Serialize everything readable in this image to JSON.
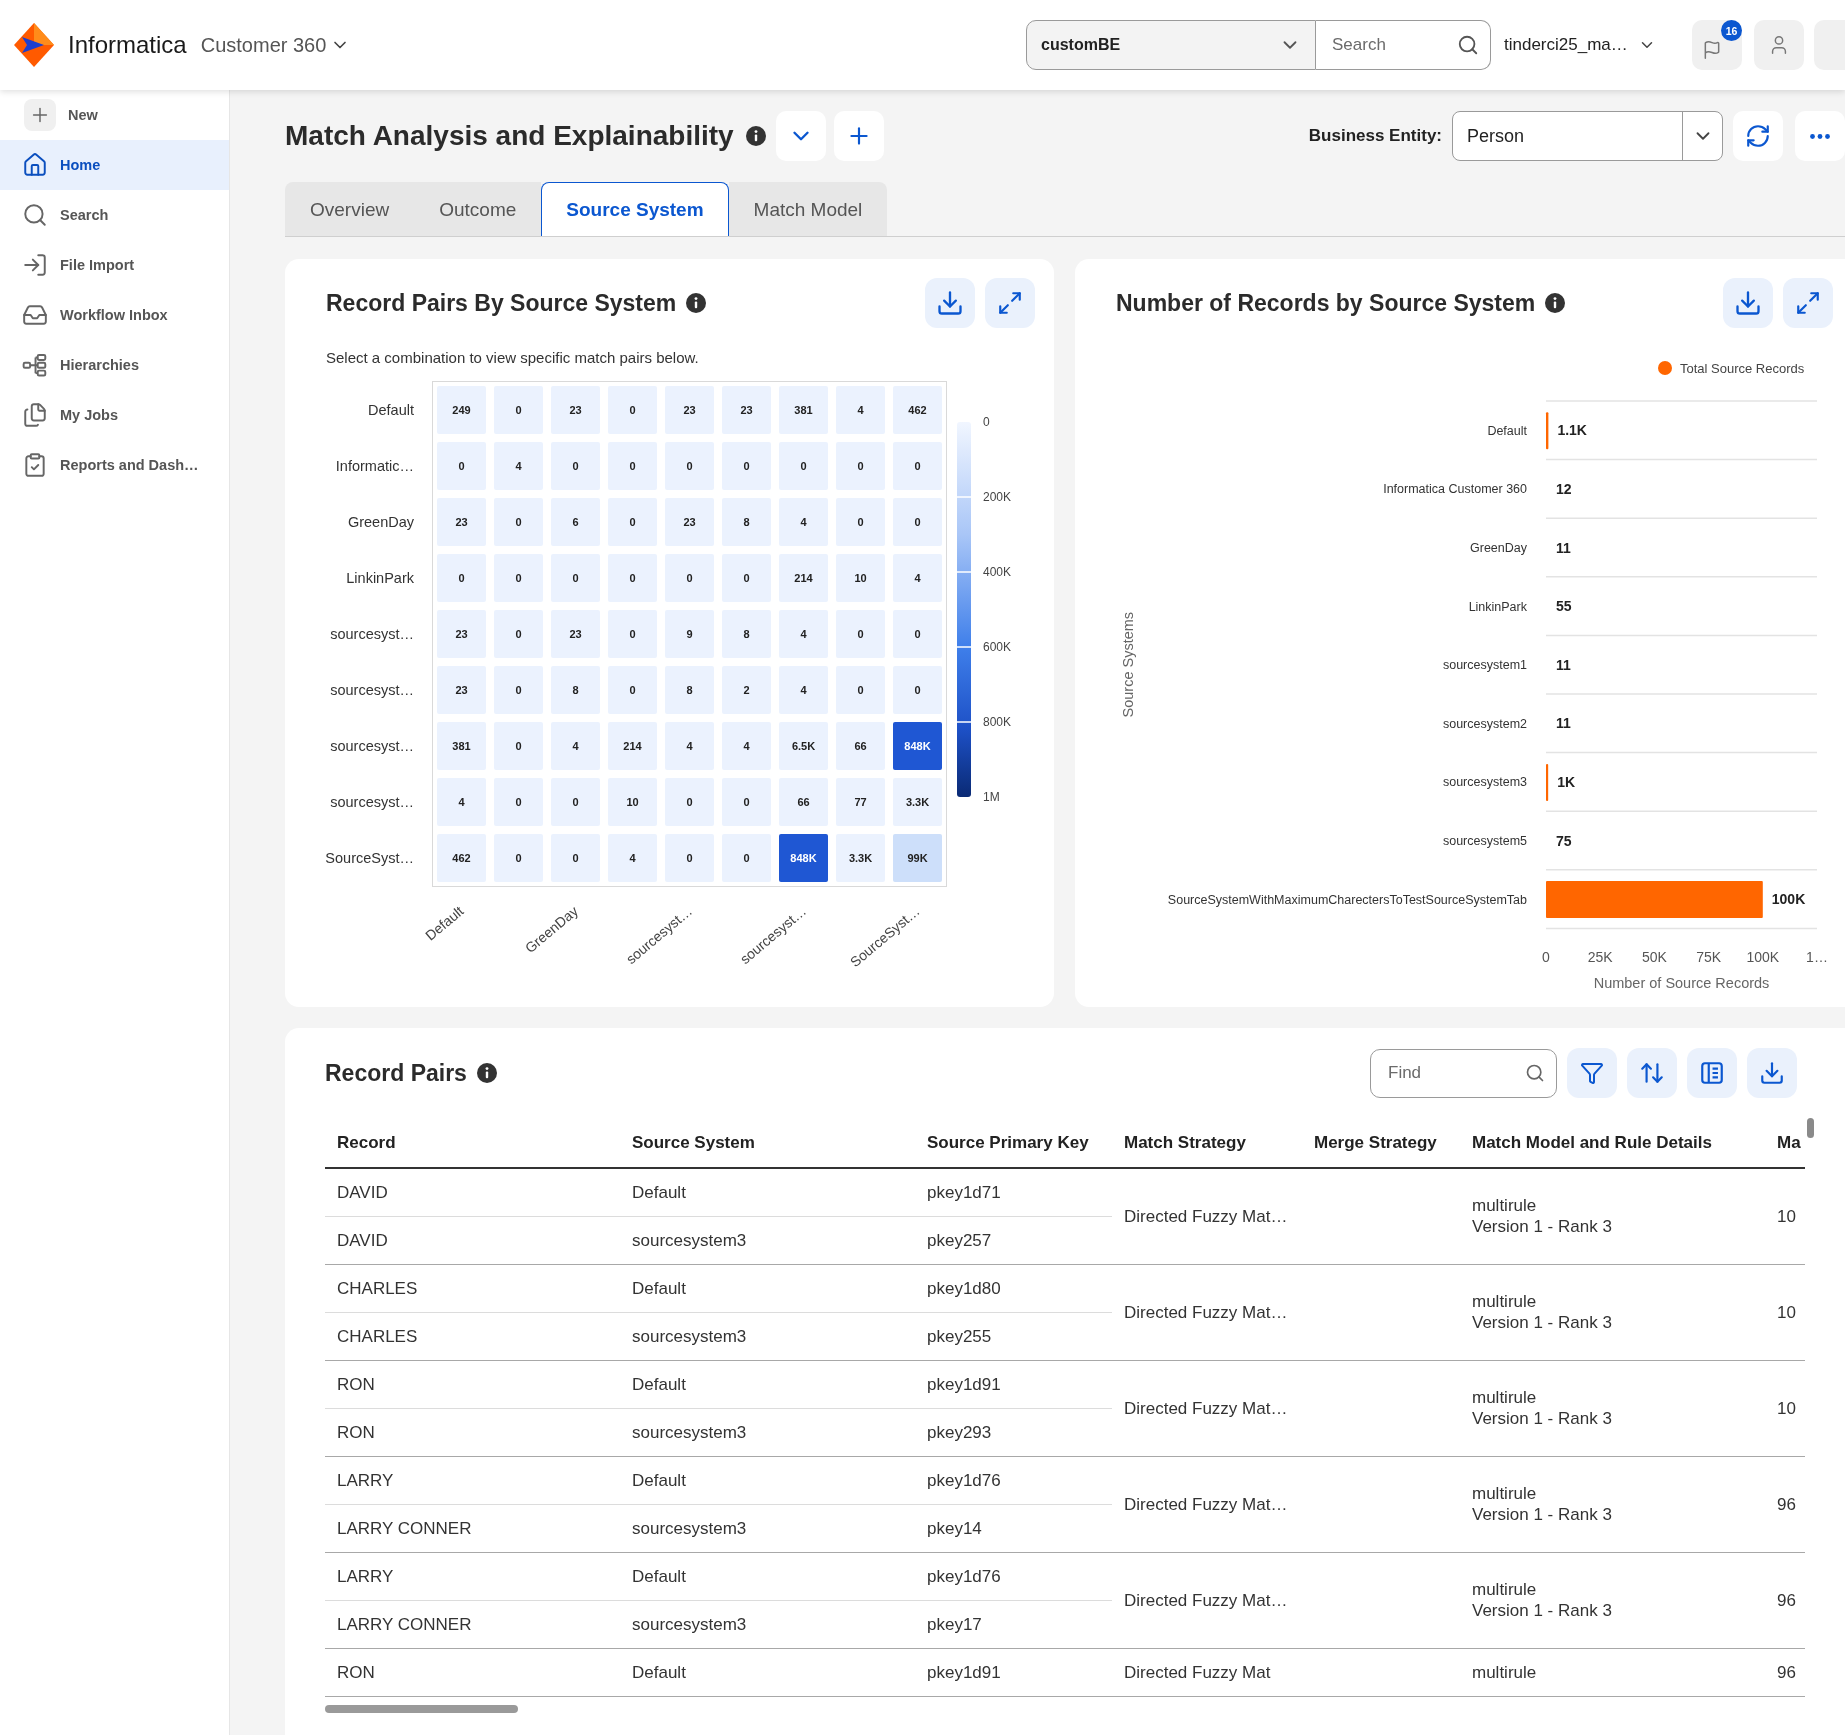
{
  "header": {
    "brand": "Informatica",
    "app_name": "Customer 360",
    "entity_select": "customBE",
    "search": {
      "placeholder": "Search"
    },
    "user": "tinderci25_ma…",
    "notifications": "16"
  },
  "sidebar": {
    "items": [
      {
        "kind": "new",
        "label": "New",
        "selected": false
      },
      {
        "kind": "home",
        "label": "Home",
        "selected": true
      },
      {
        "kind": "search",
        "label": "Search",
        "selected": false
      },
      {
        "kind": "import",
        "label": "File Import",
        "selected": false
      },
      {
        "kind": "inbox",
        "label": "Workflow Inbox",
        "selected": false
      },
      {
        "kind": "hierarchy",
        "label": "Hierarchies",
        "selected": false
      },
      {
        "kind": "jobs",
        "label": "My Jobs",
        "selected": false
      },
      {
        "kind": "reports",
        "label": "Reports and Dash…",
        "selected": false
      }
    ]
  },
  "page": {
    "title": "Match Analysis and Explainability",
    "business_entity": {
      "label": "Business Entity:",
      "value": "Person"
    }
  },
  "tabs": [
    {
      "label": "Overview",
      "selected": false
    },
    {
      "label": "Outcome",
      "selected": false
    },
    {
      "label": "Source System",
      "selected": true
    },
    {
      "label": "Match Model",
      "selected": false
    }
  ],
  "heatmap_card": {
    "title": "Record Pairs By Source System",
    "hint": "Select a combination to view specific match pairs below.",
    "rows": [
      {
        "label": "Default",
        "cells": [
          {
            "value": "249",
            "color": "#ebf2fe"
          },
          {
            "value": "0",
            "color": "#ebf2fe"
          },
          {
            "value": "23",
            "color": "#ebf2fe"
          },
          {
            "value": "0",
            "color": "#ebf2fe"
          },
          {
            "value": "23",
            "color": "#ebf2fe"
          },
          {
            "value": "23",
            "color": "#ebf2fe"
          },
          {
            "value": "381",
            "color": "#ebf2fe"
          },
          {
            "value": "4",
            "color": "#ebf2fe"
          },
          {
            "value": "462",
            "color": "#ebf2fe"
          }
        ]
      },
      {
        "label": "Informatic…",
        "cells": [
          {
            "value": "0",
            "color": "#ebf2fe"
          },
          {
            "value": "4",
            "color": "#ebf2fe"
          },
          {
            "value": "0",
            "color": "#ebf2fe"
          },
          {
            "value": "0",
            "color": "#ebf2fe"
          },
          {
            "value": "0",
            "color": "#ebf2fe"
          },
          {
            "value": "0",
            "color": "#ebf2fe"
          },
          {
            "value": "0",
            "color": "#ebf2fe"
          },
          {
            "value": "0",
            "color": "#ebf2fe"
          },
          {
            "value": "0",
            "color": "#ebf2fe"
          }
        ]
      },
      {
        "label": "GreenDay",
        "cells": [
          {
            "value": "23",
            "color": "#ebf2fe"
          },
          {
            "value": "0",
            "color": "#ebf2fe"
          },
          {
            "value": "6",
            "color": "#ebf2fe"
          },
          {
            "value": "0",
            "color": "#ebf2fe"
          },
          {
            "value": "23",
            "color": "#ebf2fe"
          },
          {
            "value": "8",
            "color": "#ebf2fe"
          },
          {
            "value": "4",
            "color": "#ebf2fe"
          },
          {
            "value": "0",
            "color": "#ebf2fe"
          },
          {
            "value": "0",
            "color": "#ebf2fe"
          }
        ]
      },
      {
        "label": "LinkinPark",
        "cells": [
          {
            "value": "0",
            "color": "#ebf2fe"
          },
          {
            "value": "0",
            "color": "#ebf2fe"
          },
          {
            "value": "0",
            "color": "#ebf2fe"
          },
          {
            "value": "0",
            "color": "#ebf2fe"
          },
          {
            "value": "0",
            "color": "#ebf2fe"
          },
          {
            "value": "0",
            "color": "#ebf2fe"
          },
          {
            "value": "214",
            "color": "#ebf2fe"
          },
          {
            "value": "10",
            "color": "#ebf2fe"
          },
          {
            "value": "4",
            "color": "#ebf2fe"
          }
        ]
      },
      {
        "label": "sourcesyst…",
        "cells": [
          {
            "value": "23",
            "color": "#ebf2fe"
          },
          {
            "value": "0",
            "color": "#ebf2fe"
          },
          {
            "value": "23",
            "color": "#ebf2fe"
          },
          {
            "value": "0",
            "color": "#ebf2fe"
          },
          {
            "value": "9",
            "color": "#ebf2fe"
          },
          {
            "value": "8",
            "color": "#ebf2fe"
          },
          {
            "value": "4",
            "color": "#ebf2fe"
          },
          {
            "value": "0",
            "color": "#ebf2fe"
          },
          {
            "value": "0",
            "color": "#ebf2fe"
          }
        ]
      },
      {
        "label": "sourcesyst…",
        "cells": [
          {
            "value": "23",
            "color": "#ebf2fe"
          },
          {
            "value": "0",
            "color": "#ebf2fe"
          },
          {
            "value": "8",
            "color": "#ebf2fe"
          },
          {
            "value": "0",
            "color": "#ebf2fe"
          },
          {
            "value": "8",
            "color": "#ebf2fe"
          },
          {
            "value": "2",
            "color": "#ebf2fe"
          },
          {
            "value": "4",
            "color": "#ebf2fe"
          },
          {
            "value": "0",
            "color": "#ebf2fe"
          },
          {
            "value": "0",
            "color": "#ebf2fe"
          }
        ]
      },
      {
        "label": "sourcesyst…",
        "cells": [
          {
            "value": "381",
            "color": "#ebf2fe"
          },
          {
            "value": "0",
            "color": "#ebf2fe"
          },
          {
            "value": "4",
            "color": "#ebf2fe"
          },
          {
            "value": "214",
            "color": "#ebf2fe"
          },
          {
            "value": "4",
            "color": "#ebf2fe"
          },
          {
            "value": "4",
            "color": "#ebf2fe"
          },
          {
            "value": "6.5K",
            "color": "#ebf2fe"
          },
          {
            "value": "66",
            "color": "#ebf2fe"
          },
          {
            "value": "848K",
            "color": "#1f57d3"
          }
        ]
      },
      {
        "label": "sourcesyst…",
        "cells": [
          {
            "value": "4",
            "color": "#ebf2fe"
          },
          {
            "value": "0",
            "color": "#ebf2fe"
          },
          {
            "value": "0",
            "color": "#ebf2fe"
          },
          {
            "value": "10",
            "color": "#ebf2fe"
          },
          {
            "value": "0",
            "color": "#ebf2fe"
          },
          {
            "value": "0",
            "color": "#ebf2fe"
          },
          {
            "value": "66",
            "color": "#ebf2fe"
          },
          {
            "value": "77",
            "color": "#ebf2fe"
          },
          {
            "value": "3.3K",
            "color": "#ebf2fe"
          }
        ]
      },
      {
        "label": "SourceSyst…",
        "cells": [
          {
            "value": "462",
            "color": "#ebf2fe"
          },
          {
            "value": "0",
            "color": "#ebf2fe"
          },
          {
            "value": "0",
            "color": "#ebf2fe"
          },
          {
            "value": "4",
            "color": "#ebf2fe"
          },
          {
            "value": "0",
            "color": "#ebf2fe"
          },
          {
            "value": "0",
            "color": "#ebf2fe"
          },
          {
            "value": "848K",
            "color": "#1f57d3"
          },
          {
            "value": "3.3K",
            "color": "#ebf2fe"
          },
          {
            "value": "99K",
            "color": "#cddffa"
          }
        ]
      }
    ],
    "x_labels": [
      "Default",
      "GreenDay",
      "sourcesyst…",
      "sourcesyst…",
      "SourceSyst…"
    ],
    "legend_ticks": [
      "0",
      "200K",
      "400K",
      "600K",
      "800K",
      "1M"
    ]
  },
  "bar_card": {
    "chart_data": {
      "type": "bar",
      "orientation": "horizontal",
      "title": "Number of Records by Source System",
      "xlabel": "Number of Source Records",
      "ylabel": "Source Systems",
      "categories": [
        "Default",
        "Informatica Customer 360",
        "GreenDay",
        "LinkinPark",
        "sourcesystem1",
        "sourcesystem2",
        "sourcesystem3",
        "sourcesystem5",
        "SourceSystemWithMaximumCharectersToTestSourceSystemTab"
      ],
      "series": [
        {
          "name": "Total Source Records",
          "color": "#ff6600",
          "values": [
            1100,
            12,
            11,
            55,
            11,
            11,
            1000,
            75,
            100000
          ]
        }
      ],
      "xlim": [
        0,
        125000
      ],
      "xticks": [
        0,
        {
          "value": 25000,
          "label": "25K"
        },
        {
          "value": 50000,
          "label": "50K"
        },
        {
          "value": 75000,
          "label": "75K"
        },
        {
          "value": 100000,
          "label": "100K"
        },
        {
          "value": 125000,
          "label": "1…"
        }
      ],
      "value_labels": [
        "1.1K",
        "12",
        "11",
        "55",
        "11",
        "11",
        "1K",
        "75",
        "100K"
      ]
    }
  },
  "record_pairs": {
    "title": "Record Pairs",
    "find": {
      "placeholder": "Find"
    },
    "columns": [
      "Record",
      "Source System",
      "Source Primary Key",
      "Match Strategy",
      "Merge Strategy",
      "Match Model and Rule Details",
      "Ma"
    ],
    "pairs": [
      {
        "records": [
          {
            "record": "DAVID",
            "source_system": "Default",
            "primary_key": "pkey1d71"
          },
          {
            "record": "DAVID",
            "source_system": "sourcesystem3",
            "primary_key": "pkey257"
          }
        ],
        "match_strategy": "Directed Fuzzy Mat…",
        "match_model": [
          "multirule",
          "Version 1 - Rank 3"
        ],
        "column_7": "10"
      },
      {
        "records": [
          {
            "record": "CHARLES",
            "source_system": "Default",
            "primary_key": "pkey1d80"
          },
          {
            "record": "CHARLES",
            "source_system": "sourcesystem3",
            "primary_key": "pkey255"
          }
        ],
        "match_strategy": "Directed Fuzzy Mat…",
        "match_model": [
          "multirule",
          "Version 1 - Rank 3"
        ],
        "column_7": "10"
      },
      {
        "records": [
          {
            "record": "RON",
            "source_system": "Default",
            "primary_key": "pkey1d91"
          },
          {
            "record": "RON",
            "source_system": "sourcesystem3",
            "primary_key": "pkey293"
          }
        ],
        "match_strategy": "Directed Fuzzy Mat…",
        "match_model": [
          "multirule",
          "Version 1 - Rank 3"
        ],
        "column_7": "10"
      },
      {
        "records": [
          {
            "record": "LARRY",
            "source_system": "Default",
            "primary_key": "pkey1d76"
          },
          {
            "record": "LARRY CONNER",
            "source_system": "sourcesystem3",
            "primary_key": "pkey14"
          }
        ],
        "match_strategy": "Directed Fuzzy Mat…",
        "match_model": [
          "multirule",
          "Version 1 - Rank 3"
        ],
        "column_7": "96"
      },
      {
        "records": [
          {
            "record": "LARRY",
            "source_system": "Default",
            "primary_key": "pkey1d76"
          },
          {
            "record": "LARRY CONNER",
            "source_system": "sourcesystem3",
            "primary_key": "pkey17"
          }
        ],
        "match_strategy": "Directed Fuzzy Mat…",
        "match_model": [
          "multirule",
          "Version 1 - Rank 3"
        ],
        "column_7": "96"
      },
      {
        "records": [
          {
            "record": "RON",
            "source_system": "Default",
            "primary_key": "pkey1d91"
          }
        ],
        "match_strategy": "Directed Fuzzy Mat",
        "match_model": [
          "multirule"
        ],
        "column_7": "96"
      }
    ]
  }
}
